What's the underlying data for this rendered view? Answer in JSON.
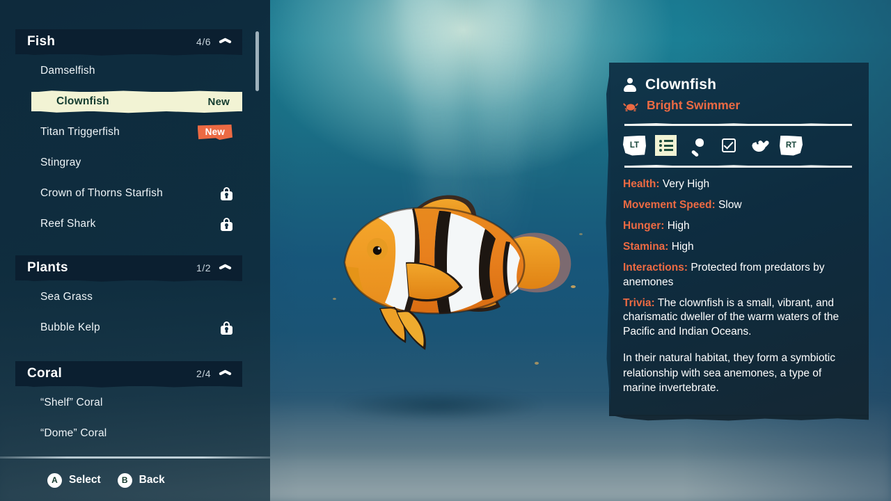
{
  "sidebar": {
    "sections": [
      {
        "title": "Fish",
        "count": "4/6",
        "items": [
          {
            "label": "Damselfish",
            "state": "normal"
          },
          {
            "label": "Clownfish",
            "state": "selected",
            "badge": "New"
          },
          {
            "label": "Titan Triggerfish",
            "state": "normal",
            "badge": "New"
          },
          {
            "label": "Stingray",
            "state": "normal"
          },
          {
            "label": "Crown of Thorns Starfish",
            "state": "locked"
          },
          {
            "label": "Reef Shark",
            "state": "locked"
          }
        ]
      },
      {
        "title": "Plants",
        "count": "1/2",
        "items": [
          {
            "label": "Sea Grass",
            "state": "normal"
          },
          {
            "label": "Bubble Kelp",
            "state": "locked"
          }
        ]
      },
      {
        "title": "Coral",
        "count": "2/4",
        "items": [
          {
            "label": "“Shelf” Coral",
            "state": "normal"
          },
          {
            "label": "“Dome” Coral",
            "state": "normal"
          }
        ]
      }
    ]
  },
  "footer": {
    "hints": [
      {
        "button": "A",
        "label": "Select"
      },
      {
        "button": "B",
        "label": "Back"
      }
    ]
  },
  "info": {
    "title": "Clownfish",
    "subtitle": "Bright Swimmer",
    "tabs": [
      {
        "icon": "lt-bumper-icon",
        "label": "LT",
        "active": false
      },
      {
        "icon": "list-icon",
        "label": "",
        "active": true
      },
      {
        "icon": "food-icon",
        "label": "",
        "active": false
      },
      {
        "icon": "checkbox-icon",
        "label": "",
        "active": false
      },
      {
        "icon": "care-heart-icon",
        "label": "",
        "active": false
      },
      {
        "icon": "rt-bumper-icon",
        "label": "RT",
        "active": false
      }
    ],
    "stats": [
      {
        "label": "Health:",
        "value": "Very High"
      },
      {
        "label": "Movement Speed:",
        "value": "Slow"
      },
      {
        "label": "Hunger:",
        "value": "High"
      },
      {
        "label": "Stamina:",
        "value": "High"
      },
      {
        "label": "Interactions:",
        "value": "Protected from predators by anemones"
      },
      {
        "label": "Trivia:",
        "value": "The clownfish is a small, vibrant, and charismatic dweller of the warm waters of the Pacific and Indian Oceans."
      }
    ],
    "paragraph": "In their natural habitat, they form a symbiotic relationship with sea anemones, a type of marine invertebrate."
  },
  "colors": {
    "accent_orange": "#ec6a43",
    "highlight_cream": "#f2f3d4",
    "selected_text": "#123b2f",
    "panel_navy": "#103348",
    "section_bar": "#0b1f30"
  }
}
